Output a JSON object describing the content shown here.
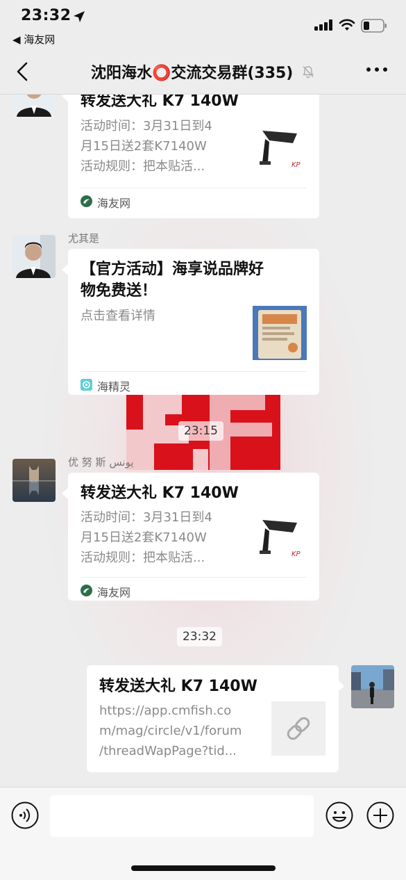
{
  "status_bar": {
    "time": "23:32",
    "back_app_label": "◀ 海友网"
  },
  "nav": {
    "title": "沈阳海水⭕交流交易群(335)"
  },
  "messages": [
    {
      "type": "link_card",
      "title": "转发送大礼 K7 140W",
      "desc_lines": [
        "活动时间：3月31日到4",
        "月15日送2套K7140W",
        "活动规则：把本贴活..."
      ],
      "source": "海友网"
    },
    {
      "type": "link_card",
      "sender": "尤其是",
      "title_lines": [
        "【官方活动】海享说品牌好",
        "物免费送！"
      ],
      "desc_lines": [
        "点击查看详情"
      ],
      "source": "海精灵"
    },
    {
      "type": "timestamp",
      "text": "23:15"
    },
    {
      "type": "link_card",
      "sender": "优 努 斯 يونس",
      "title": "转发送大礼 K7 140W",
      "desc_lines": [
        "活动时间：3月31日到4",
        "月15日送2套K7140W",
        "活动规则：把本贴活..."
      ],
      "source": "海友网"
    },
    {
      "type": "timestamp",
      "text": "23:32"
    },
    {
      "type": "link_card_self",
      "title": "转发送大礼 K7 140W",
      "desc_lines": [
        "https://app.cmfish.co",
        "m/mag/circle/v1/forum",
        "/threadWapPage?tid..."
      ]
    }
  ],
  "thumb_brand": "KP",
  "input": {
    "placeholder": ""
  },
  "colors": {
    "accent_red": "#d9111b",
    "haiyou_green": "#2c6e49",
    "haijingling_teal": "#5fcfd2"
  }
}
